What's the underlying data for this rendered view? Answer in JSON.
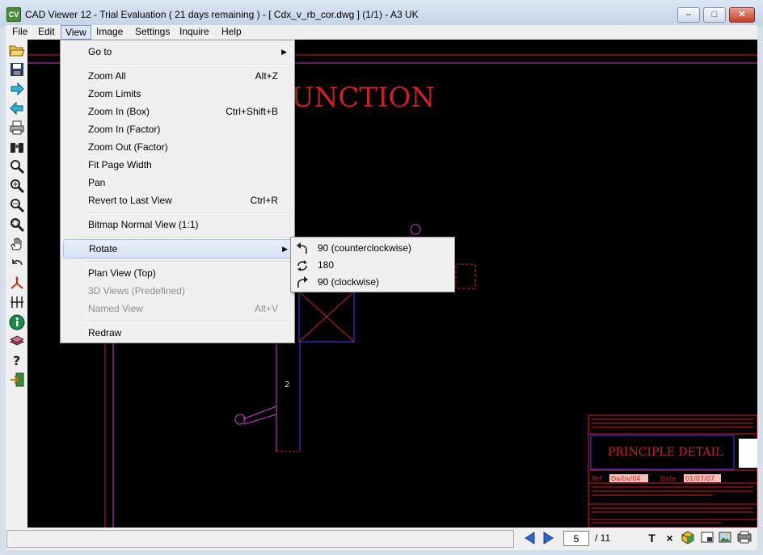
{
  "window": {
    "title": "CAD Viewer 12 - Trial Evaluation ( 21 days remaining )  -  [ Cdx_v_rb_cor.dwg ] (1/1)  -  A3 UK",
    "app_icon_text": "CV",
    "controls": {
      "minimize": "–",
      "maximize": "□",
      "close": "✕"
    }
  },
  "menubar": [
    "File",
    "Edit",
    "View",
    "Image",
    "Settings",
    "Inquire",
    "Help"
  ],
  "toolbar": {
    "tools": [
      "open-icon",
      "save-icon",
      "forward-icon",
      "back-icon",
      "print-icon",
      "binoculars-icon",
      "zoom-icon",
      "zoom-in-icon",
      "zoom-out-icon",
      "zoom-box-icon",
      "pan-hand-icon",
      "undo-icon",
      "axes-icon",
      "measure-icon",
      "info-icon",
      "layers-icon",
      "help-icon",
      "exit-icon"
    ]
  },
  "view_menu": {
    "items": [
      {
        "label": "Go to",
        "shortcut": "",
        "submenu": true,
        "disabled": false
      },
      {
        "label": "Zoom All",
        "shortcut": "Alt+Z",
        "submenu": false,
        "disabled": false
      },
      {
        "label": "Zoom Limits",
        "shortcut": "",
        "submenu": false,
        "disabled": false
      },
      {
        "label": "Zoom In (Box)",
        "shortcut": "Ctrl+Shift+B",
        "submenu": false,
        "disabled": false
      },
      {
        "label": "Zoom In (Factor)",
        "shortcut": "",
        "submenu": false,
        "disabled": false
      },
      {
        "label": "Zoom Out (Factor)",
        "shortcut": "",
        "submenu": false,
        "disabled": false
      },
      {
        "label": "Fit Page Width",
        "shortcut": "",
        "submenu": false,
        "disabled": false
      },
      {
        "label": "Pan",
        "shortcut": "",
        "submenu": false,
        "disabled": false
      },
      {
        "label": "Revert to Last View",
        "shortcut": "Ctrl+R",
        "submenu": false,
        "disabled": false
      },
      {
        "label": "Bitmap Normal View (1:1)",
        "shortcut": "",
        "submenu": false,
        "disabled": false
      },
      {
        "label": "Rotate",
        "shortcut": "",
        "submenu": true,
        "disabled": false,
        "highlighted": true
      },
      {
        "label": "Plan View (Top)",
        "shortcut": "",
        "submenu": false,
        "disabled": false
      },
      {
        "label": "3D Views (Predefined)",
        "shortcut": "",
        "submenu": false,
        "disabled": true
      },
      {
        "label": "Named View",
        "shortcut": "Alt+V",
        "submenu": false,
        "disabled": true
      },
      {
        "label": "Redraw",
        "shortcut": "",
        "submenu": false,
        "disabled": false
      }
    ]
  },
  "rotate_menu": {
    "items": [
      {
        "label": "90 (counterclockwise)",
        "icon": "rotate-ccw-icon"
      },
      {
        "label": "180",
        "icon": "rotate-180-icon"
      },
      {
        "label": "90 (clockwise)",
        "icon": "rotate-cw-icon"
      }
    ]
  },
  "drawing": {
    "heading_text": "UNCTION",
    "dimension_label": "2",
    "title_block": {
      "title": "PRINCIPLE DETAIL",
      "ref_label": "Ref",
      "ref_value": "Da/bv/04",
      "date_label": "Date",
      "date_value": "01/07/07"
    },
    "colors": {
      "background": "#000000",
      "red": "#d02020",
      "magenta": "#d040d0",
      "blue": "#4040ff"
    }
  },
  "statusbar": {
    "status_text": "",
    "page_current": "5",
    "page_total": "/ 11",
    "buttons": [
      "text-icon",
      "close-x-icon",
      "layers-3d-icon",
      "page-layout-icon",
      "image-icon",
      "print-preview-icon"
    ]
  }
}
